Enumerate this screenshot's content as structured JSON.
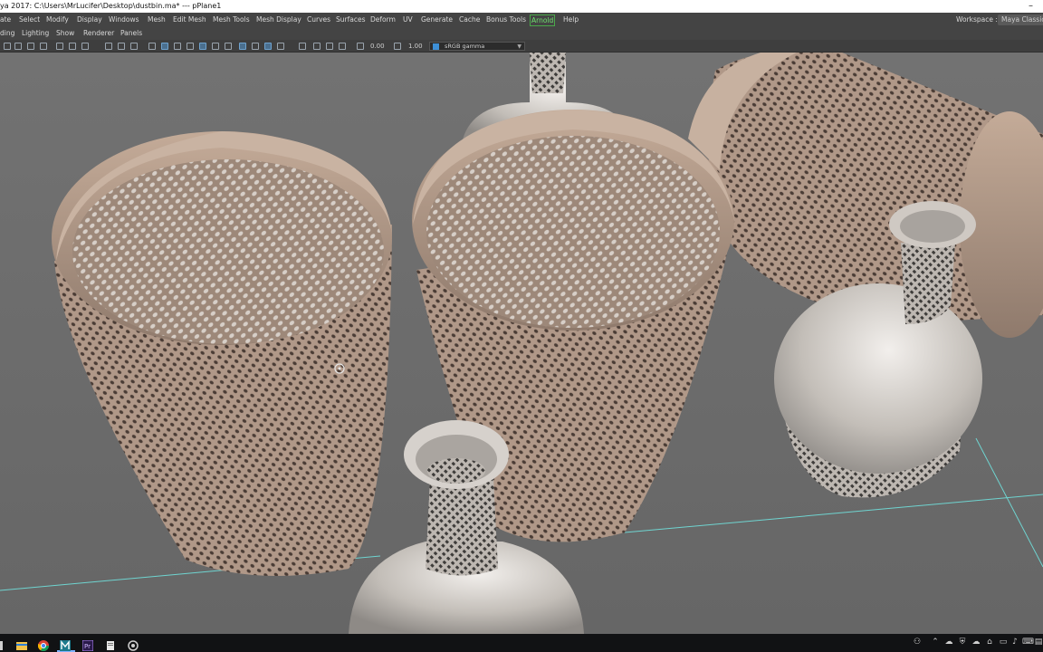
{
  "window": {
    "title": "ya 2017: C:\\Users\\MrLucifer\\Desktop\\dustbin.ma*   ---   pPlane1",
    "minimize_glyph": "–"
  },
  "menubar": {
    "items": [
      "ate",
      "Select",
      "Modify",
      "Display",
      "Windows",
      "Mesh",
      "Edit Mesh",
      "Mesh Tools",
      "Mesh Display",
      "Curves",
      "Surfaces",
      "Deform",
      "UV",
      "Generate",
      "Cache",
      "Bonus Tools",
      "Arnold",
      "Help"
    ],
    "workspace_label": "Workspace :",
    "workspace_value": "Maya Classic"
  },
  "panel_menu": {
    "items": [
      "ding",
      "Lighting",
      "Show",
      "Renderer",
      "Panels"
    ]
  },
  "toolbar": {
    "exposure": "0.00",
    "gamma": "1.00",
    "color_space": "sRGB gamma"
  },
  "taskbar": {
    "apps": [
      "windows-start-icon",
      "file-explorer-icon",
      "chrome-icon",
      "maya-icon",
      "premiere-icon",
      "notepad-icon",
      "settings-icon"
    ],
    "tray_icons": [
      "people-icon",
      "chevron-up-icon",
      "onedrive-icon",
      "shield-icon",
      "cloud-icon",
      "network-icon",
      "battery-icon",
      "volume-icon",
      "language-icon",
      "notification-icon"
    ]
  },
  "colors": {
    "menu_bg": "#444444",
    "viewport_bg": "#6c6c6c",
    "basket": "#b29b8b",
    "vase": "#c6c1bb",
    "grid_line": "#6fd4d0",
    "arnold": "#6fe06f"
  }
}
